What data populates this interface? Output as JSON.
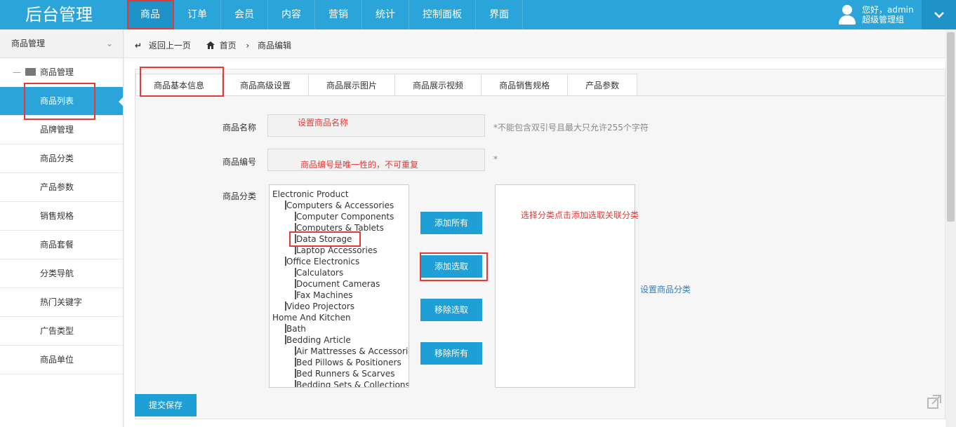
{
  "app": {
    "title": "后台管理"
  },
  "nav": {
    "items": [
      {
        "label": "商品",
        "active": true
      },
      {
        "label": "订单"
      },
      {
        "label": "会员"
      },
      {
        "label": "内容"
      },
      {
        "label": "营销"
      },
      {
        "label": "统计"
      },
      {
        "label": "控制面板"
      },
      {
        "label": "界面"
      }
    ]
  },
  "user": {
    "greeting": "您好，admin",
    "role": "超级管理组",
    "menu_icon": "chevron-down-icon"
  },
  "sidebar": {
    "header": "商品管理",
    "group": "商品管理",
    "items": [
      {
        "label": "商品列表",
        "active": true
      },
      {
        "label": "品牌管理"
      },
      {
        "label": "商品分类"
      },
      {
        "label": "产品参数"
      },
      {
        "label": "销售规格"
      },
      {
        "label": "商品套餐"
      },
      {
        "label": "分类导航"
      },
      {
        "label": "热门关键字"
      },
      {
        "label": "广告类型"
      },
      {
        "label": "商品单位"
      }
    ]
  },
  "breadcrumb": {
    "back": "返回上一页",
    "home": "首页",
    "current": "商品编辑"
  },
  "tabs": [
    {
      "label": "商品基本信息",
      "active": true
    },
    {
      "label": "商品高级设置"
    },
    {
      "label": "商品展示图片"
    },
    {
      "label": "商品展示视频"
    },
    {
      "label": "商品销售规格"
    },
    {
      "label": "产品参数"
    }
  ],
  "form": {
    "name": {
      "label": "商品名称",
      "placeholder": "设置商品名称",
      "hint": "*不能包含双引号且最大只允许255个字符"
    },
    "code": {
      "label": "商品编号",
      "placeholder": "商品编号是唯一性的，不可重复",
      "hint": "*"
    },
    "category": {
      "label": "商品分类"
    }
  },
  "category_tree": [
    {
      "text": "Electronic Product",
      "level": 1
    },
    {
      "text": "Computers & Accessories",
      "level": 2
    },
    {
      "text": "Computer Components",
      "level": 3
    },
    {
      "text": "Computers & Tablets",
      "level": 3
    },
    {
      "text": "Data Storage",
      "level": 3,
      "selected": true
    },
    {
      "text": "Laptop Accessories",
      "level": 3
    },
    {
      "text": "Office Electronics",
      "level": 2
    },
    {
      "text": "Calculators",
      "level": 3
    },
    {
      "text": "Document Cameras",
      "level": 3
    },
    {
      "text": "Fax Machines",
      "level": 3
    },
    {
      "text": "Video Projectors",
      "level": 2
    },
    {
      "text": "Home And Kitchen",
      "level": 1
    },
    {
      "text": "Bath",
      "level": 2
    },
    {
      "text": "Bedding Article",
      "level": 2
    },
    {
      "text": "Air Mattresses & Accessories",
      "level": 3
    },
    {
      "text": "Bed Pillows & Positioners",
      "level": 3
    },
    {
      "text": "Bed Runners & Scarves",
      "level": 3
    },
    {
      "text": "Bedding Sets & Collections",
      "level": 3
    }
  ],
  "buttons": {
    "add_all": "添加所有",
    "add_selected": "添加选取",
    "remove_selected": "移除选取",
    "remove_all": "移除所有"
  },
  "annotations": {
    "target_note": "选择分类点击添加选取关联分类",
    "side_note": "设置商品分类"
  },
  "submit": "提交保存",
  "colors": {
    "primary": "#2ba5d9",
    "button": "#1e9fd6",
    "highlight": "#e53935"
  }
}
